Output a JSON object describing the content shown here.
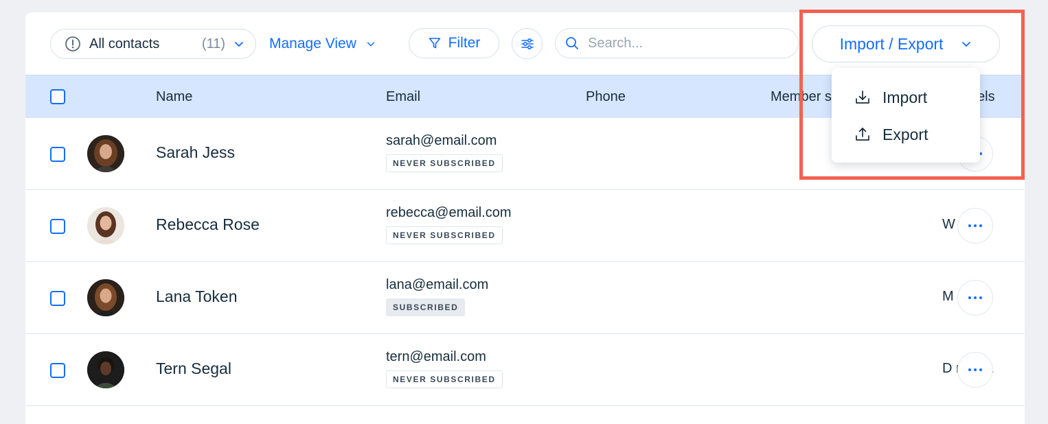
{
  "toolbar": {
    "view_label": "All contacts",
    "view_count": "(11)",
    "manage_view_label": "Manage View",
    "filter_label": "Filter",
    "search_placeholder": "Search...",
    "import_export_label": "Import / Export"
  },
  "table": {
    "columns": [
      "Name",
      "Email",
      "Phone",
      "Member s",
      "els"
    ],
    "rows": [
      {
        "name": "Sarah Jess",
        "email": "sarah@email.com",
        "status": "NEVER SUBSCRIBED",
        "label": "s"
      },
      {
        "name": "Rebecca Rose",
        "email": "rebecca@email.com",
        "status": "NEVER SUBSCRIBED",
        "label": "W s"
      },
      {
        "name": "Lana Token",
        "email": "lana@email.com",
        "status": "SUBSCRIBED",
        "label": "M ans"
      },
      {
        "name": "Tern Segal",
        "email": "tern@email.com",
        "status": "NEVER SUBSCRIBED",
        "label": "D ns tea"
      }
    ]
  },
  "dropdown": {
    "items": [
      {
        "label": "Import",
        "icon": "download-icon"
      },
      {
        "label": "Export",
        "icon": "upload-icon"
      }
    ]
  },
  "colors": {
    "accent": "#116dff",
    "header_bg": "#d6e6fe",
    "highlight": "#f2624f"
  }
}
